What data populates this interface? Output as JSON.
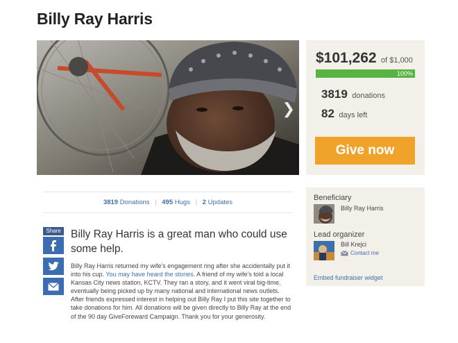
{
  "page": {
    "title": "Billy Ray Harris"
  },
  "donation": {
    "amount": "$101,262",
    "goal": "of $1,000",
    "progress_percent": 100,
    "progress_label": "100%",
    "donations_count": "3819",
    "donations_label": "donations",
    "days_count": "82",
    "days_label": "days left",
    "give_button": "Give now"
  },
  "stats_bar": {
    "donations_count": "3819",
    "donations_label": "Donations",
    "hugs_count": "495",
    "hugs_label": "Hugs",
    "updates_count": "2",
    "updates_label": "Updates"
  },
  "share": {
    "label": "Share",
    "buttons": [
      "facebook-icon",
      "twitter-icon",
      "email-icon"
    ]
  },
  "story": {
    "headline": "Billy Ray Harris is a great man who could use some help.",
    "body_part1": "Billy Ray Harris returned my wife's engagement ring after she accidentally put it into his cup. ",
    "body_link": "You may have heard the stories",
    "body_part2": ". A friend of my wife's told a local Kansas City news station, KCTV. They ran a story, and it went viral big-time, eventually being picked up by many national and international news outlets. After friends expressed interest in helping out Billy Ray I put this site together to take donations for him. All donations will be given directly to Billy Ray at the end of the 90 day GiveForeward Campaign. Thank you for your generosity."
  },
  "side": {
    "beneficiary_heading": "Beneficiary",
    "beneficiary_name": "Billy Ray Harris",
    "organizer_heading": "Lead organizer",
    "organizer_name": "Bill Krejci",
    "contact_label": "Contact me",
    "embed_label": "Embed fundraiser widget"
  },
  "colors": {
    "progress": "#57b442",
    "give_button": "#f0a32a",
    "link": "#3d6fae",
    "panel_bg": "#f3efe9"
  }
}
